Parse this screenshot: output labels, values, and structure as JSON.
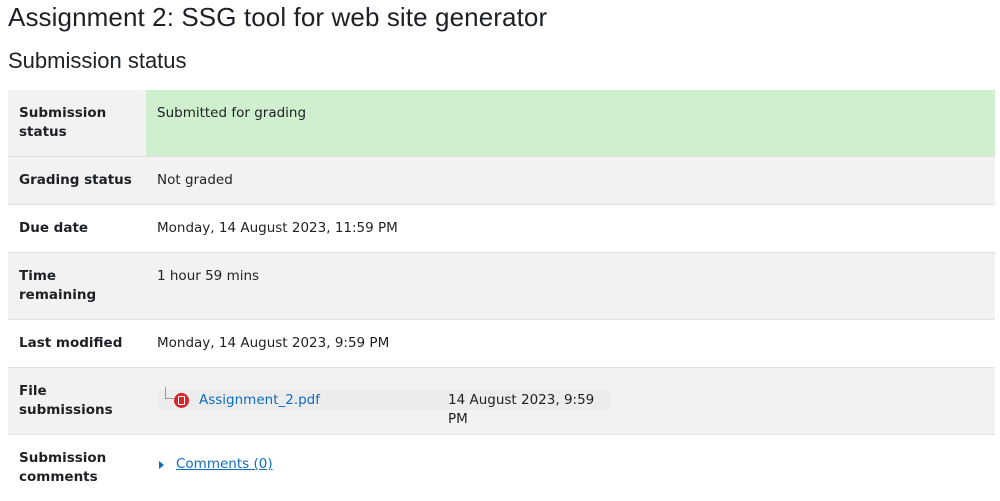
{
  "assignment_title": "Assignment 2: SSG tool for web site generator",
  "section_title": "Submission status",
  "rows": {
    "submission_status": {
      "label": "Submission status",
      "value": "Submitted for grading"
    },
    "grading_status": {
      "label": "Grading status",
      "value": "Not graded"
    },
    "due_date": {
      "label": "Due date",
      "value": "Monday, 14 August 2023, 11:59 PM"
    },
    "time_remaining": {
      "label": "Time remaining",
      "value": "1 hour 59 mins"
    },
    "last_modified": {
      "label": "Last modified",
      "value": "Monday, 14 August 2023, 9:59 PM"
    },
    "file_submissions": {
      "label": "File submissions",
      "file_name": "Assignment_2.pdf",
      "file_date": "14 August 2023, 9:59 PM",
      "file_icon": "pdf-file-icon"
    },
    "submission_comments": {
      "label": "Submission comments",
      "link": "Comments (0)"
    }
  },
  "colors": {
    "submitted_bg": "#cfefcf",
    "link": "#0f6cbf",
    "row_alt_bg": "#f2f2f2"
  }
}
